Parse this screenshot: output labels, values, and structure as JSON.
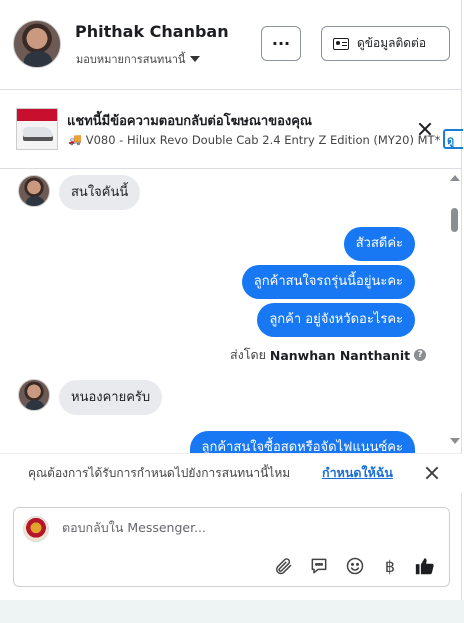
{
  "header": {
    "contact_name": "Phithak Chanban",
    "assign_label": "มอบหมายการสนทนานี้",
    "more_label": "···",
    "contact_info_label": "ดูข้อมูลติดต่อ"
  },
  "ad": {
    "title": "แชทนี้มีข้อความตอบกลับต่อโฆษณาของคุณ",
    "subtitle": "V080 - Hilux Revo Double Cab 2.4 Entry Z Edition (MY20) MT*...",
    "view_label": "ดู"
  },
  "messages": [
    {
      "direction": "in",
      "text": "สนใจคันนี้"
    },
    {
      "direction": "out",
      "text": "สัวสดีค่ะ"
    },
    {
      "direction": "out",
      "text": "ลูกค้าสนใจรถรุ่นนี้อยู่นะคะ"
    },
    {
      "direction": "out",
      "text": "ลูกค้า อยู่จังหวัดอะไรคะ"
    },
    {
      "direction": "in",
      "text": "หนองคายครับ"
    },
    {
      "direction": "out",
      "text": "ลูกค้าสนใจซื้อสดหรือจัดไฟแนนซ์คะ"
    }
  ],
  "sent_by": {
    "prefix": "ส่งโดย",
    "name": "Nanwhan Nanthanit",
    "info": "?"
  },
  "folder_suggest": {
    "text": "คุณต้องการได้รับการกำหนดไปยังการสนทนานี้ไหม",
    "link": "กำหนดให้ฉัน"
  },
  "composer": {
    "placeholder": "ตอบกลับใน Messenger..."
  },
  "icons": {
    "attach": "paperclip-icon",
    "saved_replies": "chat-bubble-icon",
    "emoji": "smiley-icon",
    "payment": "baht-icon",
    "like": "thumbs-up-icon"
  }
}
